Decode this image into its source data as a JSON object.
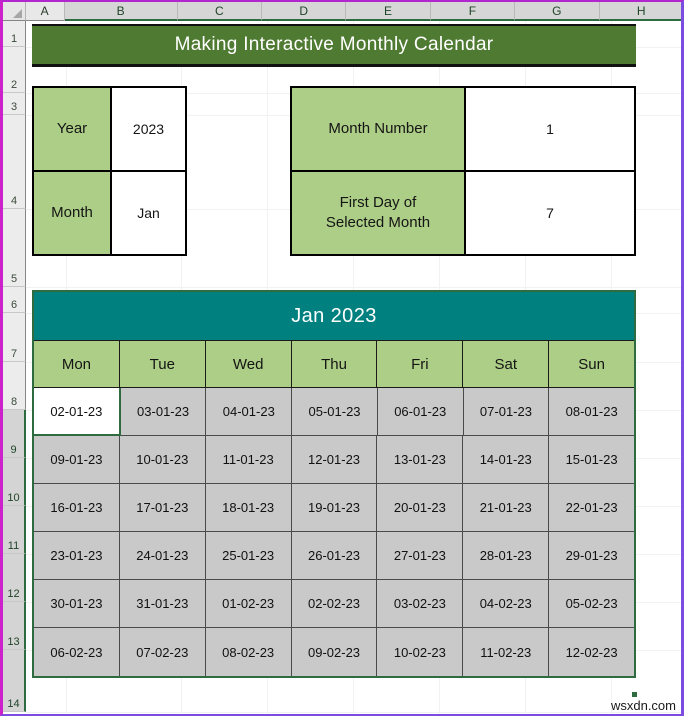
{
  "spreadsheet": {
    "columns": [
      "A",
      "B",
      "C",
      "D",
      "E",
      "F",
      "G",
      "H"
    ],
    "selected_columns": [
      "B",
      "C",
      "D",
      "E",
      "F",
      "G",
      "H"
    ],
    "rows": [
      "1",
      "2",
      "3",
      "4",
      "5",
      "6",
      "7",
      "8",
      "9",
      "10",
      "11",
      "12",
      "13",
      "14"
    ],
    "selected_rows": [
      "9",
      "10",
      "11",
      "12",
      "13",
      "14"
    ],
    "select_all_icon": "select-all-triangle-icon"
  },
  "banner": {
    "title": "Making Interactive Monthly Calendar"
  },
  "inputs": {
    "left_panel": [
      {
        "label": "Year",
        "value": "2023"
      },
      {
        "label": "Month",
        "value": "Jan"
      }
    ],
    "right_panel": [
      {
        "label": "Month Number",
        "value": "1"
      },
      {
        "label": "First Day of\nSelected Month",
        "value": "7"
      }
    ]
  },
  "calendar": {
    "title": "Jan 2023",
    "weekdays": [
      "Mon",
      "Tue",
      "Wed",
      "Thu",
      "Fri",
      "Sat",
      "Sun"
    ],
    "weeks": [
      [
        "02-01-23",
        "03-01-23",
        "04-01-23",
        "05-01-23",
        "06-01-23",
        "07-01-23",
        "08-01-23"
      ],
      [
        "09-01-23",
        "10-01-23",
        "11-01-23",
        "12-01-23",
        "13-01-23",
        "14-01-23",
        "15-01-23"
      ],
      [
        "16-01-23",
        "17-01-23",
        "18-01-23",
        "19-01-23",
        "20-01-23",
        "21-01-23",
        "22-01-23"
      ],
      [
        "23-01-23",
        "24-01-23",
        "25-01-23",
        "26-01-23",
        "27-01-23",
        "28-01-23",
        "29-01-23"
      ],
      [
        "30-01-23",
        "31-01-23",
        "01-02-23",
        "02-02-23",
        "03-02-23",
        "04-02-23",
        "05-02-23"
      ],
      [
        "06-02-23",
        "07-02-23",
        "08-02-23",
        "09-02-23",
        "10-02-23",
        "11-02-23",
        "12-02-23"
      ]
    ],
    "active_cell": {
      "week": 0,
      "day": 0
    }
  },
  "watermark": {
    "text": "wsxdn.com"
  },
  "colors": {
    "banner_green": "#4F7A32",
    "label_green": "#ADCE86",
    "calendar_teal": "#00807F",
    "cell_gray": "#C9C9C9",
    "selection_border": "#2F6B41",
    "header_accent_magenta": "#CC22CC"
  }
}
